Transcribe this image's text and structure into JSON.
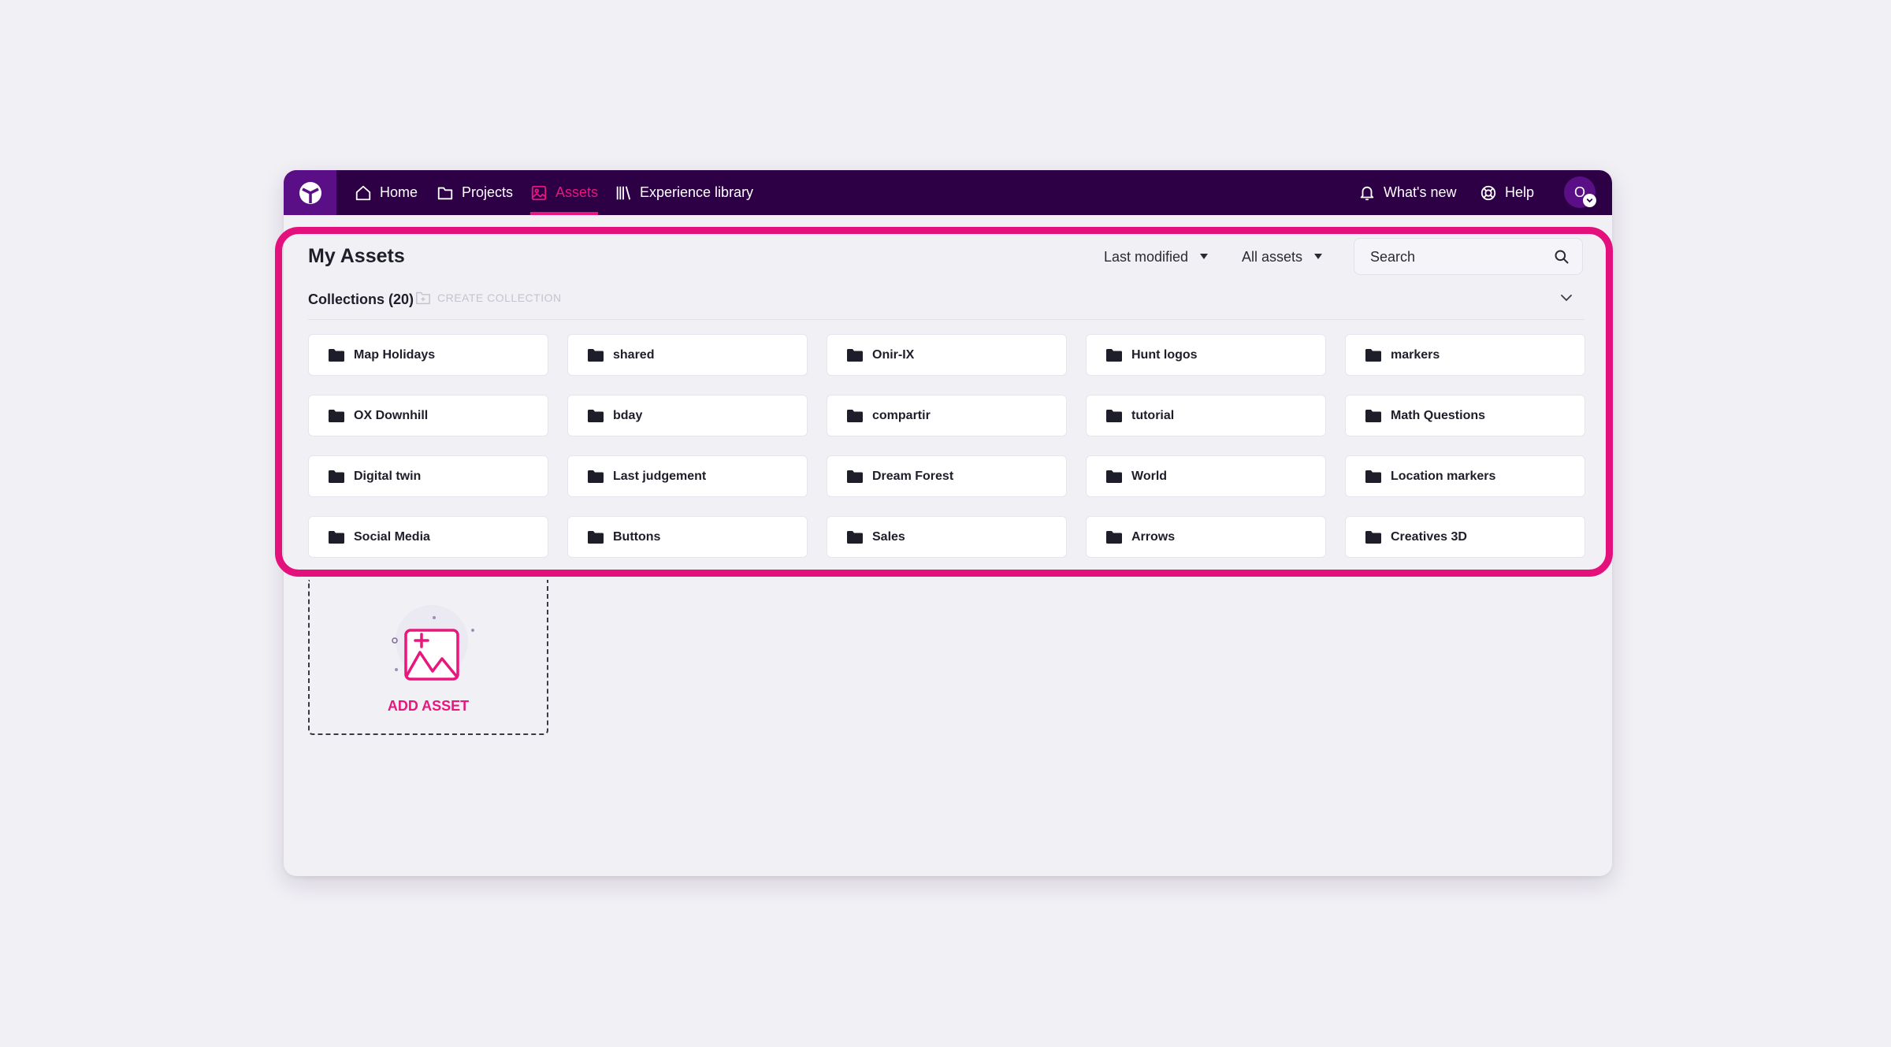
{
  "topbar": {
    "logo": "app-logo-icon",
    "nav": [
      {
        "label": "Home",
        "icon": "home-icon"
      },
      {
        "label": "Projects",
        "icon": "folder-icon"
      },
      {
        "label": "Assets",
        "icon": "image-icon",
        "active": true
      },
      {
        "label": "Experience library",
        "icon": "library-icon"
      }
    ],
    "whats_new": {
      "label": "What's new",
      "icon": "bell-icon"
    },
    "help": {
      "label": "Help",
      "icon": "lifebuoy-icon"
    },
    "avatar": {
      "initial": "O",
      "badge_icon": "chevron-down-icon"
    }
  },
  "main": {
    "title": "My Assets",
    "sort": {
      "selected": "Last modified"
    },
    "filter": {
      "selected": "All assets"
    },
    "search": {
      "placeholder": "Search",
      "value": ""
    },
    "collections": {
      "title": "Collections (20)",
      "create_label": "CREATE COLLECTION",
      "items": [
        "Map Holidays",
        "shared",
        "Onir-IX",
        "Hunt logos",
        "markers",
        "OX Downhill",
        "bday",
        "compartir",
        "tutorial",
        "Math Questions",
        "Digital twin",
        "Last judgement",
        "Dream Forest",
        "World",
        "Location markers",
        "Social Media",
        "Buttons",
        "Sales",
        "Arrows",
        "Creatives 3D"
      ]
    },
    "add_asset": {
      "label": "ADD ASSET"
    }
  },
  "colors": {
    "topbar_bg": "#2d0045",
    "logo_bg": "#5b0f86",
    "accent": "#e8177d",
    "highlight": "#e4117c",
    "page_bg": "#f1f0f5"
  }
}
